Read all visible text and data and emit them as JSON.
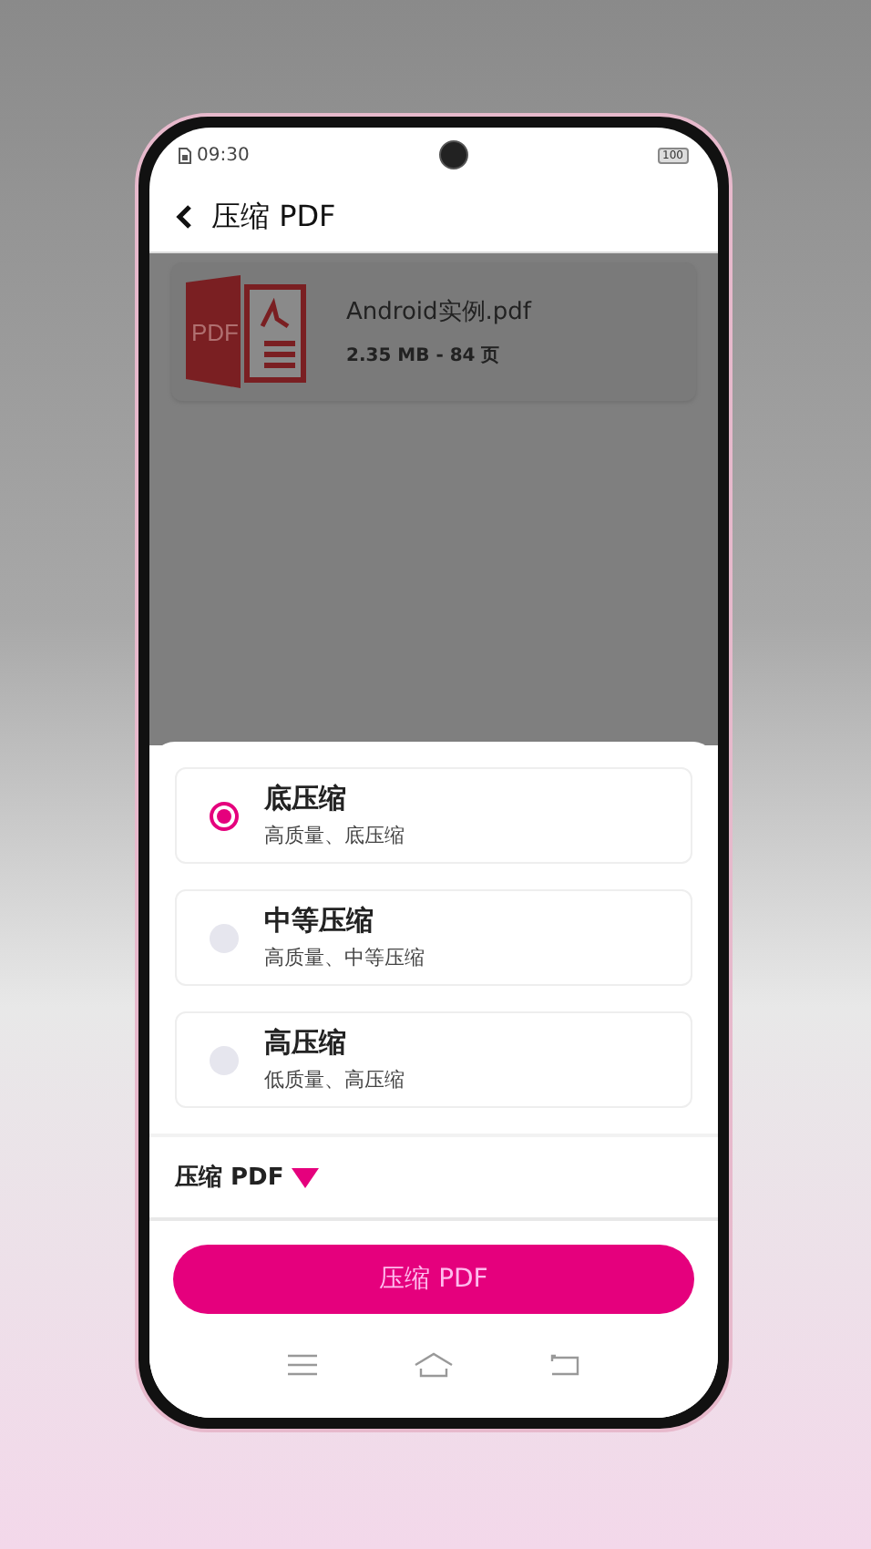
{
  "status_bar": {
    "time": "09:30",
    "battery": "100"
  },
  "header": {
    "title": "压缩 PDF"
  },
  "file": {
    "name": "Android实例.pdf",
    "info": "2.35 MB - 84 页",
    "icon_text": "PDF"
  },
  "options": [
    {
      "title": "底压缩",
      "subtitle": "高质量、底压缩",
      "selected": true
    },
    {
      "title": "中等压缩",
      "subtitle": "高质量、中等压缩",
      "selected": false
    },
    {
      "title": "高压缩",
      "subtitle": "低质量、高压缩",
      "selected": false
    }
  ],
  "section": {
    "label": "压缩 PDF",
    "expanded": true
  },
  "action_button": {
    "label": "压缩 PDF"
  }
}
